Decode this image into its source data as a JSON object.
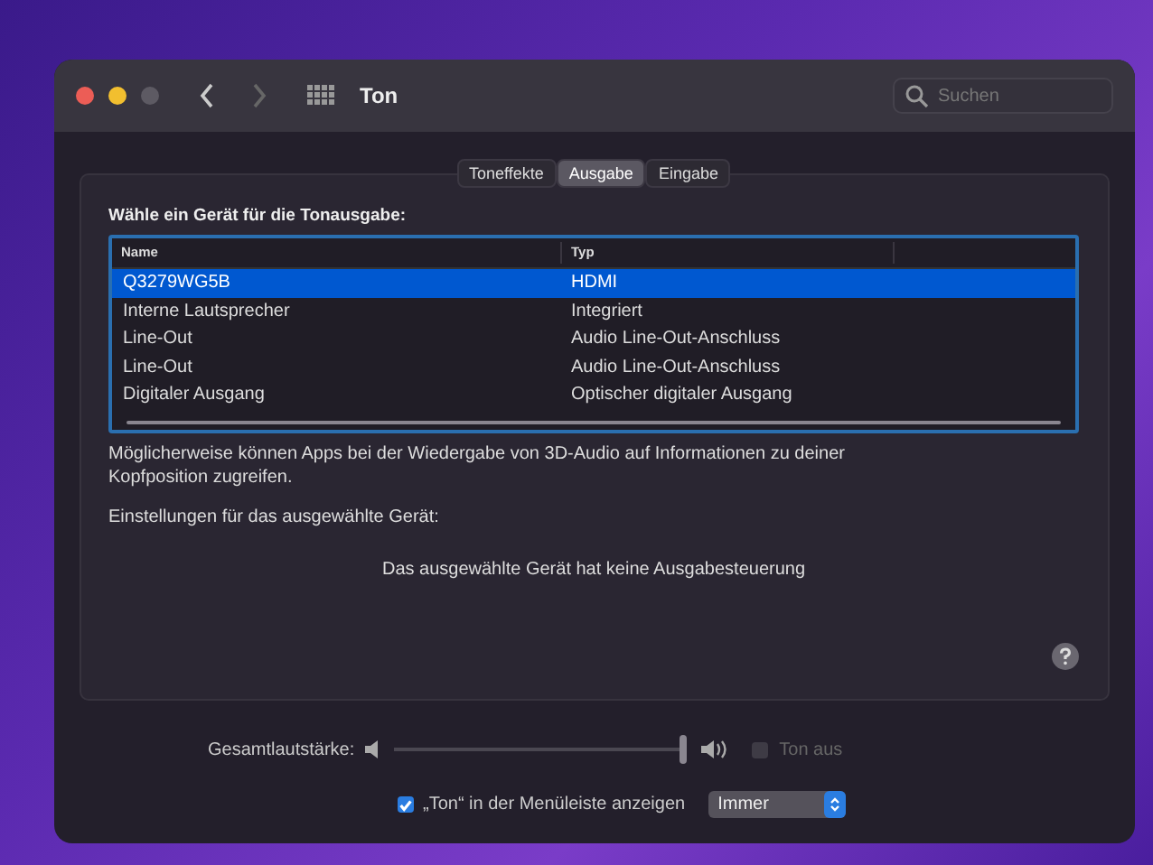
{
  "window": {
    "title": "Ton"
  },
  "search": {
    "placeholder": "Suchen"
  },
  "tabs": [
    {
      "label": "Toneffekte",
      "selected": false
    },
    {
      "label": "Ausgabe",
      "selected": true
    },
    {
      "label": "Eingabe",
      "selected": false
    }
  ],
  "device_prompt": "Wähle ein Gerät für die Tonausgabe:",
  "table": {
    "columns": [
      "Name",
      "Typ"
    ],
    "rows": [
      {
        "name": "Q3279WG5B",
        "type": "HDMI",
        "selected": true
      },
      {
        "name": "Interne Lautsprecher",
        "type": "Integriert",
        "selected": false
      },
      {
        "name": "Line-Out",
        "type": "Audio Line-Out-Anschluss",
        "selected": false
      },
      {
        "name": "Line-Out",
        "type": "Audio Line-Out-Anschluss",
        "selected": false
      },
      {
        "name": "Digitaler Ausgang",
        "type": "Optischer digitaler Ausgang",
        "selected": false
      }
    ]
  },
  "note": "Möglicherweise können Apps bei der Wiedergabe von 3D-Audio auf Informationen zu deiner Kopfposition zugreifen.",
  "settings_label": "Einstellungen für das ausgewählte Gerät:",
  "no_controls": "Das ausgewählte Gerät hat keine Ausgabesteuerung",
  "volume": {
    "label": "Gesamtlautstärke:",
    "level": 1.0,
    "mute_label": "Ton aus",
    "muted": false
  },
  "menubar": {
    "label": "„Ton“ in der Menüleiste anzeigen",
    "checked": true,
    "option": "Immer"
  }
}
